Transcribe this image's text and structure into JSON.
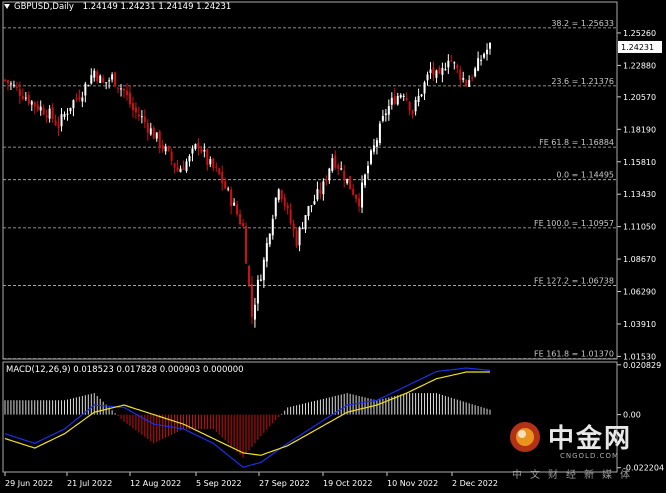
{
  "header": {
    "symbol_tf": "GBPUSD,Daily",
    "ohlc": "1.24149 1.24231 1.24149 1.24231"
  },
  "macd_header": "MACD(12,26,9) 0.018523 0.017828 0.000903 0.000000",
  "colors": {
    "background": "#000000",
    "bull": "#ffffff",
    "bear": "#d01010",
    "grid": "#808080",
    "macd_line": "#1b2ee8",
    "signal_line": "#f0e020"
  },
  "price_axis": {
    "ticks": [
      "1.25260",
      "1.22880",
      "1.20570",
      "1.18190",
      "1.15810",
      "1.13430",
      "1.11050",
      "1.08670",
      "1.06290",
      "1.03910",
      "1.01530"
    ],
    "current_price": "1.24231"
  },
  "macd_axis": {
    "ticks": [
      "0.020829",
      "0.00",
      "-0.022204"
    ]
  },
  "time_axis": {
    "ticks": [
      "29 Jun 2022",
      "21 Jul 2022",
      "12 Aug 2022",
      "5 Sep 2022",
      "27 Sep 2022",
      "19 Oct 2022",
      "10 Nov 2022",
      "2 Dec 2022"
    ]
  },
  "fib_levels": [
    {
      "label": "38.2 = 1.25633",
      "price": 1.25633
    },
    {
      "label": "23.6 = 1.21376",
      "price": 1.21376
    },
    {
      "label": "FE 61.8 = 1.16884",
      "price": 1.16884
    },
    {
      "label": "0.0 = 1.14495",
      "price": 1.14495
    },
    {
      "label": "FE 100.0 = 1.10957",
      "price": 1.10957
    },
    {
      "label": "FE 127.2 = 1.06738",
      "price": 1.06738
    },
    {
      "label": "FE 161.8 = 1.01370",
      "price": 1.0137
    }
  ],
  "watermark": {
    "cn": "中金网",
    "en": "CNGOLD.COM",
    "sub": "中文财经新媒体"
  },
  "chart_data": {
    "type": "candlestick",
    "symbol": "GBPUSD",
    "timeframe": "Daily",
    "close_path": [
      [
        0,
        1.218
      ],
      [
        6,
        1.208
      ],
      [
        10,
        1.2
      ],
      [
        14,
        1.195
      ],
      [
        18,
        1.185
      ],
      [
        22,
        1.2
      ],
      [
        26,
        1.21
      ],
      [
        30,
        1.225
      ],
      [
        33,
        1.215
      ],
      [
        36,
        1.22
      ],
      [
        40,
        1.21
      ],
      [
        43,
        1.196
      ],
      [
        46,
        1.19
      ],
      [
        50,
        1.178
      ],
      [
        54,
        1.166
      ],
      [
        58,
        1.152
      ],
      [
        62,
        1.16
      ],
      [
        65,
        1.172
      ],
      [
        68,
        1.158
      ],
      [
        72,
        1.148
      ],
      [
        76,
        1.13
      ],
      [
        80,
        1.11
      ],
      [
        83,
        1.045
      ],
      [
        85,
        1.068
      ],
      [
        87,
        1.085
      ],
      [
        89,
        1.11
      ],
      [
        92,
        1.142
      ],
      [
        95,
        1.12
      ],
      [
        98,
        1.1
      ],
      [
        101,
        1.12
      ],
      [
        104,
        1.13
      ],
      [
        107,
        1.14
      ],
      [
        110,
        1.162
      ],
      [
        113,
        1.152
      ],
      [
        116,
        1.14
      ],
      [
        119,
        1.13
      ],
      [
        122,
        1.155
      ],
      [
        125,
        1.175
      ],
      [
        128,
        1.195
      ],
      [
        131,
        1.205
      ],
      [
        134,
        1.21
      ],
      [
        137,
        1.195
      ],
      [
        140,
        1.21
      ],
      [
        143,
        1.225
      ],
      [
        146,
        1.218
      ],
      [
        149,
        1.236
      ],
      [
        152,
        1.225
      ],
      [
        155,
        1.216
      ],
      [
        158,
        1.225
      ],
      [
        161,
        1.238
      ],
      [
        163,
        1.2423
      ]
    ],
    "macd_path": [
      [
        0,
        -0.008
      ],
      [
        10,
        -0.012
      ],
      [
        20,
        -0.006
      ],
      [
        30,
        0.004
      ],
      [
        40,
        0.003
      ],
      [
        50,
        -0.004
      ],
      [
        60,
        -0.006
      ],
      [
        70,
        -0.012
      ],
      [
        80,
        -0.022
      ],
      [
        86,
        -0.02
      ],
      [
        95,
        -0.012
      ],
      [
        105,
        -0.004
      ],
      [
        115,
        0.004
      ],
      [
        125,
        0.006
      ],
      [
        135,
        0.012
      ],
      [
        145,
        0.018
      ],
      [
        155,
        0.0195
      ],
      [
        163,
        0.0185
      ]
    ],
    "signal_path": [
      [
        0,
        -0.01
      ],
      [
        10,
        -0.014
      ],
      [
        20,
        -0.008
      ],
      [
        30,
        0.001
      ],
      [
        40,
        0.004
      ],
      [
        50,
        0.0
      ],
      [
        60,
        -0.004
      ],
      [
        70,
        -0.01
      ],
      [
        80,
        -0.016
      ],
      [
        86,
        -0.017
      ],
      [
        95,
        -0.013
      ],
      [
        105,
        -0.006
      ],
      [
        115,
        0.001
      ],
      [
        125,
        0.004
      ],
      [
        135,
        0.009
      ],
      [
        145,
        0.015
      ],
      [
        155,
        0.0178
      ],
      [
        163,
        0.0178
      ]
    ],
    "num_bars": 164,
    "price_range": [
      1.0134,
      1.2665
    ],
    "macd_range": [
      -0.024,
      0.022
    ]
  }
}
